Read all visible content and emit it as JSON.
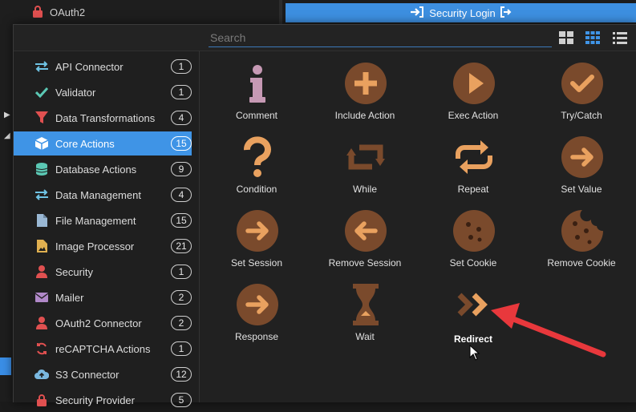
{
  "background": {
    "top_left_item": "OAuth2",
    "top_right_button": "Security Login"
  },
  "search": {
    "placeholder": "Search",
    "value": ""
  },
  "view_modes": [
    "large-grid-icon",
    "small-grid-icon",
    "list-icon"
  ],
  "categories": [
    {
      "label": "API Connector",
      "count": "1",
      "icon": "arrows-exchange-icon",
      "color": "#6fc3e4"
    },
    {
      "label": "Validator",
      "count": "1",
      "icon": "check-icon",
      "color": "#5bc8b4"
    },
    {
      "label": "Data Transformations",
      "count": "4",
      "icon": "funnel-icon",
      "color": "#e05050"
    },
    {
      "label": "Core Actions",
      "count": "15",
      "icon": "cube-icon",
      "color": "#ffffff",
      "active": true
    },
    {
      "label": "Database Actions",
      "count": "9",
      "icon": "database-icon",
      "color": "#5bc8b4"
    },
    {
      "label": "Data Management",
      "count": "4",
      "icon": "arrows-exchange-icon",
      "color": "#6fc3e4"
    },
    {
      "label": "File Management",
      "count": "15",
      "icon": "file-icon",
      "color": "#9ab8d4"
    },
    {
      "label": "Image Processor",
      "count": "21",
      "icon": "image-file-icon",
      "color": "#e0b050"
    },
    {
      "label": "Security",
      "count": "1",
      "icon": "user-icon",
      "color": "#e05050"
    },
    {
      "label": "Mailer",
      "count": "2",
      "icon": "envelope-icon",
      "color": "#b088c8"
    },
    {
      "label": "OAuth2 Connector",
      "count": "2",
      "icon": "user-icon",
      "color": "#e05050"
    },
    {
      "label": "reCAPTCHA Actions",
      "count": "1",
      "icon": "recaptcha-icon",
      "color": "#e05050"
    },
    {
      "label": "S3 Connector",
      "count": "12",
      "icon": "cloud-upload-icon",
      "color": "#7ab8e0"
    },
    {
      "label": "Security Provider",
      "count": "5",
      "icon": "lock-icon",
      "color": "#e05050"
    }
  ],
  "actions": [
    {
      "label": "Comment",
      "icon": "info-icon"
    },
    {
      "label": "Include Action",
      "icon": "plus-circle-icon"
    },
    {
      "label": "Exec Action",
      "icon": "play-circle-icon"
    },
    {
      "label": "Try/Catch",
      "icon": "check-circle-icon"
    },
    {
      "label": "Condition",
      "icon": "question-icon"
    },
    {
      "label": "While",
      "icon": "loop-square-icon"
    },
    {
      "label": "Repeat",
      "icon": "repeat-icon"
    },
    {
      "label": "Set Value",
      "icon": "arrow-right-circle-icon"
    },
    {
      "label": "Set Session",
      "icon": "arrow-right-circle-icon"
    },
    {
      "label": "Remove Session",
      "icon": "arrow-left-circle-icon"
    },
    {
      "label": "Set Cookie",
      "icon": "cookie-icon"
    },
    {
      "label": "Remove Cookie",
      "icon": "bitten-cookie-icon"
    },
    {
      "label": "Response",
      "icon": "arrow-right-circle-icon"
    },
    {
      "label": "Wait",
      "icon": "hourglass-icon"
    },
    {
      "label": "Redirect",
      "icon": "double-chevron-right-icon",
      "highlighted": true
    }
  ],
  "colors": {
    "accent": "#3f94e6",
    "icon_fill": "#7a4a2c",
    "icon_glyph": "#e9a15f",
    "comment_icon": "#c699b4",
    "annotation_arrow": "#e8383c"
  }
}
